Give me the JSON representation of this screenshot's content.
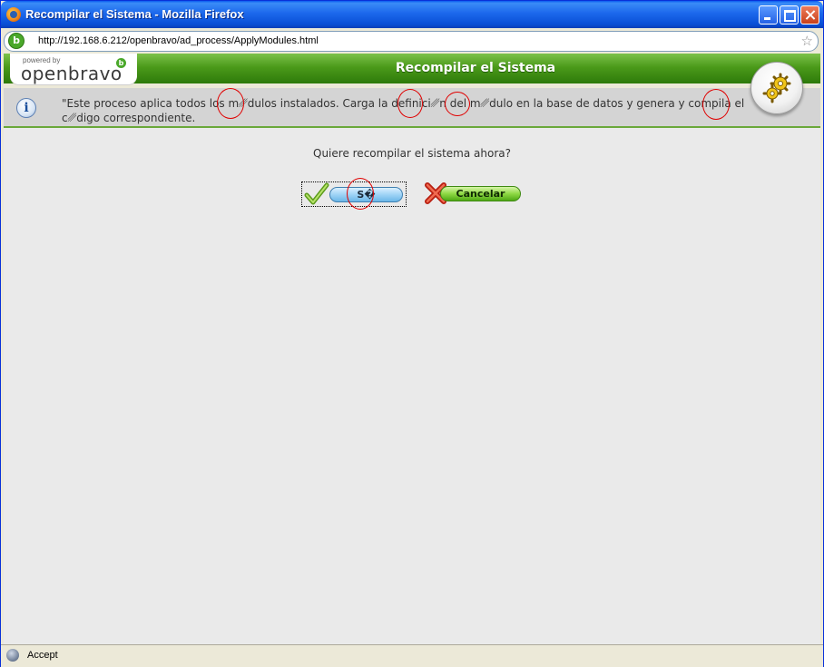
{
  "window": {
    "title": "Recompilar el Sistema - Mozilla Firefox"
  },
  "urlbar": {
    "url": "http://192.168.6.212/openbravo/ad_process/ApplyModules.html"
  },
  "header": {
    "logo_powered": "powered by",
    "logo_name": "openbravo",
    "title": "Recompilar el Sistema",
    "gear_icon": "gears-icon"
  },
  "info": {
    "icon": "info-icon",
    "text": "\"Este proceso aplica todos los m\u0000dulos instalados. Carga la definici\u0000n del m\u0000dulo en la base de datos y genera y compila el c\u0000digo correspondiente."
  },
  "dialog": {
    "question": "Quiere recompilar el sistema ahora?",
    "yes_label": "S�",
    "cancel_label": "Cancelar"
  },
  "statusbar": {
    "text": "Accept"
  },
  "colors": {
    "brand_green": "#4b9a1a",
    "annotation_red": "#e00000"
  }
}
